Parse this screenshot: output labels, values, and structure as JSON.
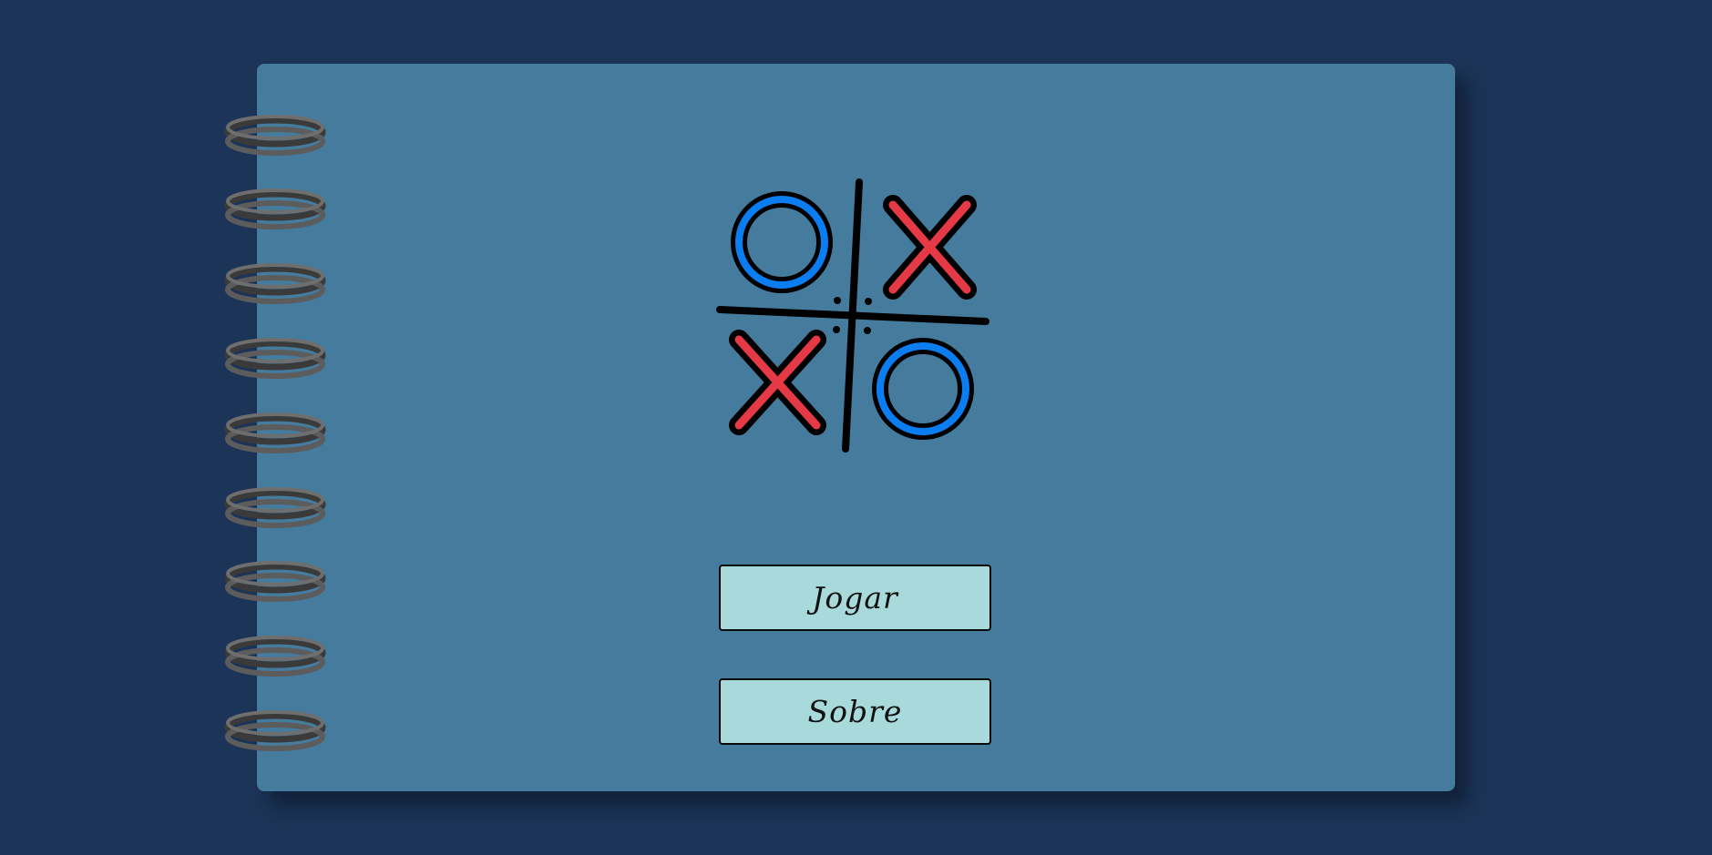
{
  "app": {
    "logo_icon": "tic-tac-toe-icon",
    "colors": {
      "background": "#1c3457",
      "notebook": "#457b9d",
      "button": "#a8dadc",
      "x_mark": "#e63946",
      "o_mark": "#0a7ef0",
      "ring": "#5a5a5a"
    }
  },
  "menu": {
    "play_label": "Jogar",
    "about_label": "Sobre"
  },
  "spiral": {
    "icon": "spiral-binding-ring-icon",
    "ring_count": 9
  }
}
